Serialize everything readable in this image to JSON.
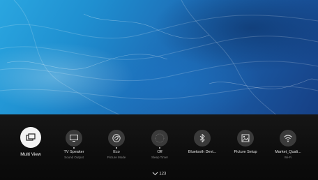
{
  "menu": {
    "items": [
      {
        "label": "Multi View",
        "sublabel": "",
        "icon": "multi-view-icon",
        "selected": true
      },
      {
        "label": "TV Speaker",
        "sublabel": "Sound Output",
        "icon": "tv-speaker-icon"
      },
      {
        "label": "Eco",
        "sublabel": "Picture Mode",
        "icon": "picture-mode-icon"
      },
      {
        "label": "Off",
        "sublabel": "Sleep Timer",
        "icon": "sleep-timer-icon"
      },
      {
        "label": "Bluetooth Devi...",
        "sublabel": "",
        "icon": "bluetooth-icon"
      },
      {
        "label": "Picture Setup",
        "sublabel": "",
        "icon": "picture-setup-icon"
      },
      {
        "label": "Market_Quali...",
        "sublabel": "Wi-Fi",
        "icon": "wifi-icon"
      }
    ]
  },
  "footer": {
    "page_label": "123",
    "icon": "chevron-down-icon"
  },
  "colors": {
    "bar_background": "#111111",
    "selected_icon_bg": "#f3f3f3",
    "wallpaper_accent": "#1f8fd0"
  }
}
